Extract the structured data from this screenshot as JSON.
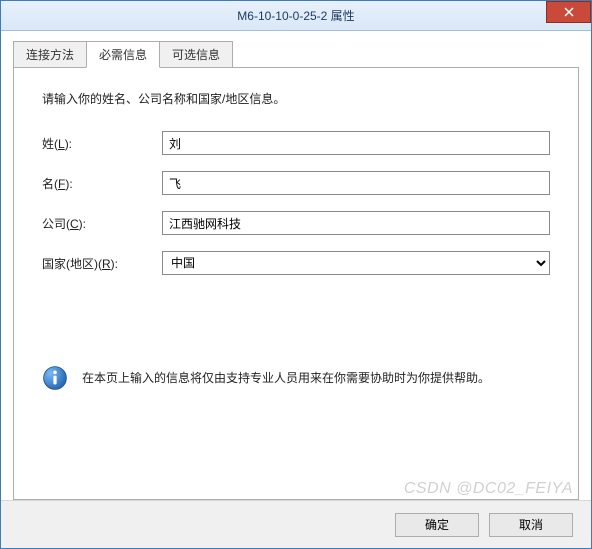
{
  "window": {
    "title": "M6-10-10-0-25-2 属性"
  },
  "tabs": {
    "connection": "连接方法",
    "required": "必需信息",
    "optional": "可选信息"
  },
  "form": {
    "instructions": "请输入你的姓名、公司名称和国家/地区信息。",
    "lastname_label_pre": "姓(",
    "lastname_label_u": "L",
    "lastname_label_post": "):",
    "lastname_value": "刘",
    "firstname_label_pre": "名(",
    "firstname_label_u": "F",
    "firstname_label_post": "):",
    "firstname_value": "飞",
    "company_label_pre": "公司(",
    "company_label_u": "C",
    "company_label_post": "):",
    "company_value": "江西驰网科技",
    "country_label_pre": "国家(地区)(",
    "country_label_u": "R",
    "country_label_post": "):",
    "country_value": "中国"
  },
  "info": {
    "text": "在本页上输入的信息将仅由支持专业人员用来在你需要协助时为你提供帮助。"
  },
  "buttons": {
    "ok": "确定",
    "cancel": "取消"
  },
  "watermark": "CSDN @DC02_FEIYA"
}
